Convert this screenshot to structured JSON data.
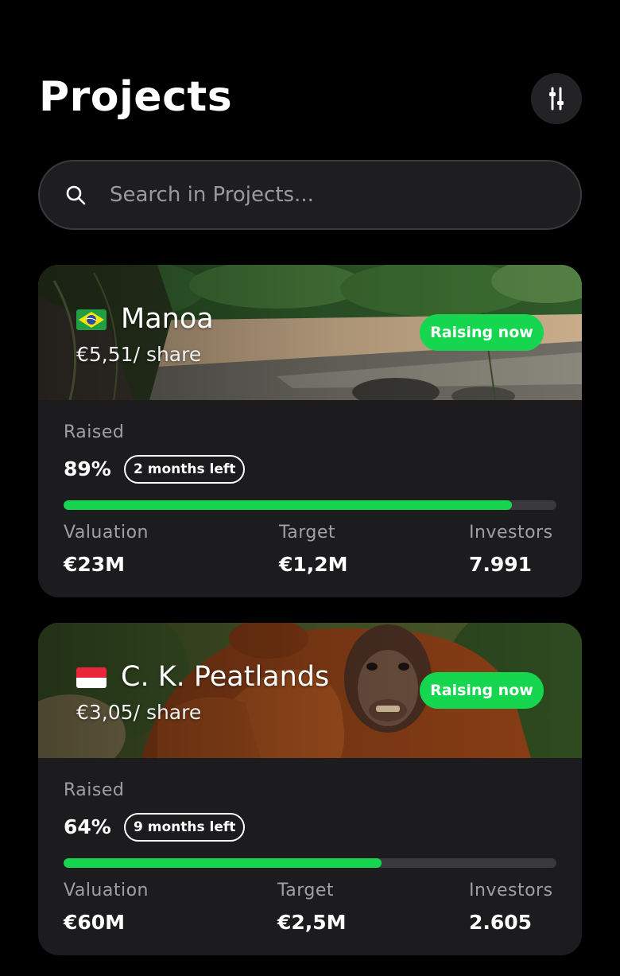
{
  "header": {
    "title": "Projects"
  },
  "search": {
    "placeholder": "Search in Projects..."
  },
  "projects": [
    {
      "name": "Manoa",
      "price": "€5,51/ share",
      "status": "Raising now",
      "raised_label": "Raised",
      "raised_pct": "89%",
      "progress": 0.91,
      "time_left": "2 months left",
      "valuation_label": "Valuation",
      "valuation": "€23M",
      "target_label": "Target",
      "target": "€1,2M",
      "investors_label": "Investors",
      "investors": "7.991",
      "flag": "brazil-flag"
    },
    {
      "name": "C. K. Peatlands",
      "price": "€3,05/ share",
      "status": "Raising now",
      "raised_label": "Raised",
      "raised_pct": "64%",
      "progress": 0.645,
      "time_left": "9 months left",
      "valuation_label": "Valuation",
      "valuation": "€60M",
      "target_label": "Target",
      "target": "€2,5M",
      "investors_label": "Investors",
      "investors": "2.605",
      "flag": "indonesia-flag"
    }
  ],
  "colors": {
    "accent": "#16d650",
    "card": "#1c1c1e",
    "background": "#000000"
  }
}
